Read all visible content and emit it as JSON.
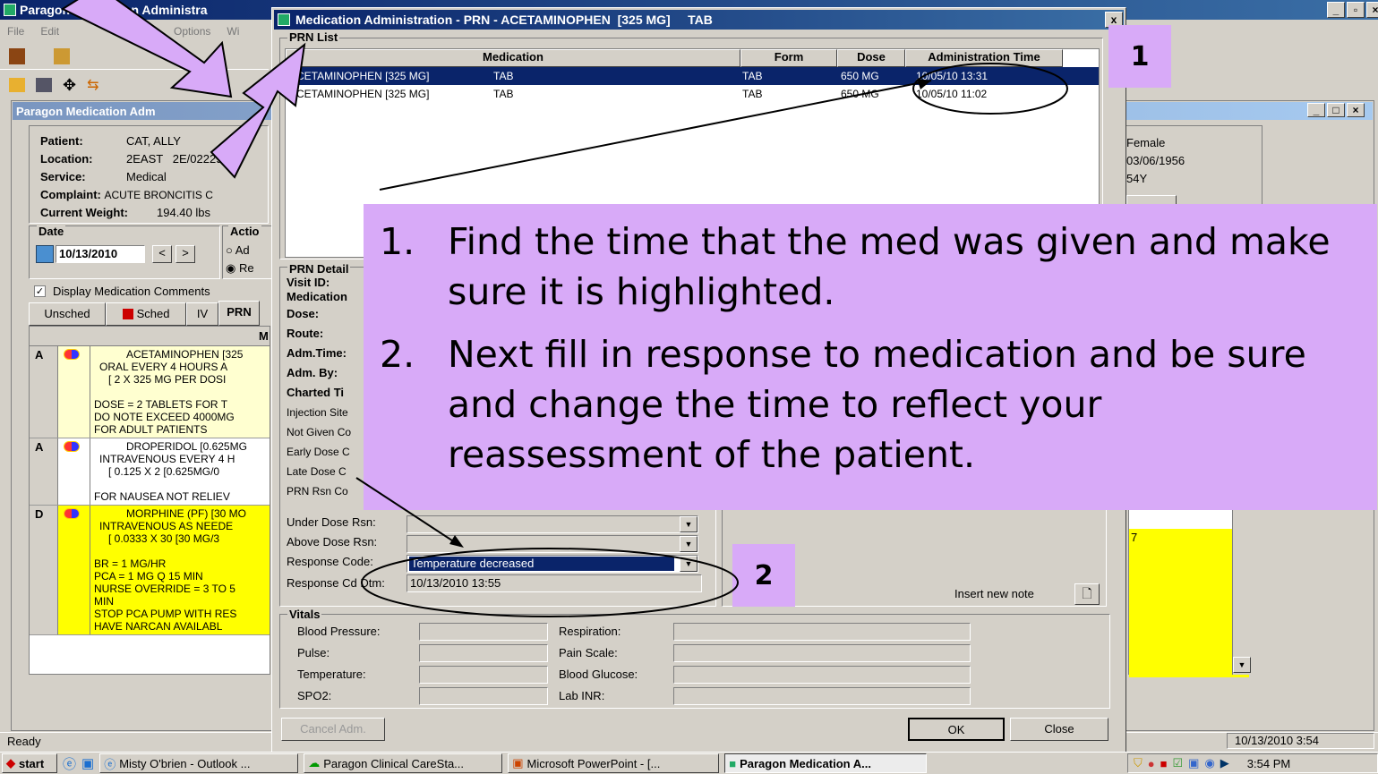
{
  "main_window": {
    "title": "Paragon Medication Administra",
    "menus": [
      "File",
      "Edit",
      "Options",
      "Wi"
    ]
  },
  "child_window": {
    "title": "Paragon Medication Adm"
  },
  "patient": {
    "patient_label": "Patient:",
    "patient_value": "CAT, ALLY",
    "location_label": "Location:",
    "location_value": "2EAST   2E/02229/A",
    "service_label": "Service:",
    "service_value": "Medical",
    "complaint_label": "Complaint:",
    "complaint_value": "ACUTE BRONCITIS C",
    "weight_label": "Current Weight:",
    "weight_value": "194.40 lbs",
    "sex": "Female",
    "dob": "03/06/1956",
    "age": "54Y"
  },
  "date_group": {
    "label": "Date",
    "value": "10/13/2010",
    "prev": "<",
    "next": ">"
  },
  "action_group": {
    "label": "Actio",
    "opt1": "Ad",
    "opt2": "Re"
  },
  "display_comments": "Display Medication Comments",
  "tabs": [
    "Unsched",
    "Sched",
    "IV",
    "PRN"
  ],
  "med_header": "M",
  "med_rows": [
    {
      "status": "A",
      "lines": [
        "ACETAMINOPHEN  [325",
        "ORAL EVERY 4 HOURS A",
        "[ 2 X 325 MG PER DOSI",
        "",
        "DOSE = 2 TABLETS FOR T",
        "DO NOTE EXCEED 4000MG",
        "FOR ADULT PATIENTS"
      ]
    },
    {
      "status": "A",
      "lines": [
        "DROPERIDOL  [0.625MG",
        "INTRAVENOUS EVERY 4 H",
        "[ 0.125 X 2 [0.625MG/0",
        "",
        "FOR NAUSEA NOT RELIEV"
      ]
    },
    {
      "status": "D",
      "lines": [
        "MORPHINE (PF)  [30 MO",
        "INTRAVENOUS AS NEEDE",
        "[ 0.0333 X 30 [30 MG/3",
        "",
        "BR = 1 MG/HR",
        "PCA = 1 MG Q 15 MIN",
        "NURSE OVERRIDE = 3 TO 5",
        "MIN",
        "STOP PCA PUMP WITH RES",
        "HAVE NARCAN AVAILABL"
      ]
    }
  ],
  "right_col_value": "7",
  "status_bar": {
    "left": "Ready",
    "right": "10/13/2010 3:54"
  },
  "dialog": {
    "title": "Medication Administration - PRN - ACETAMINOPHEN  [325 MG]     TAB",
    "close": "x",
    "prn_list_label": "PRN List",
    "columns": [
      "Medication",
      "Form",
      "Dose",
      "Administration Time"
    ],
    "rows": [
      {
        "med": "ACETAMINOPHEN  [325 MG]",
        "tab": "TAB",
        "form": "TAB",
        "dose": "650 MG",
        "time": "10/05/10 13:31"
      },
      {
        "med": "ACETAMINOPHEN  [325 MG]",
        "tab": "TAB",
        "form": "TAB",
        "dose": "650 MG",
        "time": "10/05/10 11:02"
      }
    ],
    "prn_detail_label": "PRN Detail",
    "detail_labels": [
      "Visit ID:",
      "Medication",
      "Dose:",
      "Route:",
      "Adm.Time:",
      "Adm. By:",
      "Charted Ti",
      "Injection Site",
      "Not Given Co",
      "Early Dose C",
      "Late Dose C",
      "PRN Rsn Co"
    ],
    "under_dose": "Under Dose Rsn:",
    "above_dose": "Above Dose Rsn:",
    "response_code_label": "Response Code:",
    "response_code_value": "Temperature decreased",
    "response_dtm_label": "Response Cd Dtm:",
    "response_dtm_value": "10/13/2010 13:55",
    "insert_note": "Insert new note",
    "vitals_label": "Vitals",
    "vitals_left": [
      "Blood Pressure:",
      "Pulse:",
      "Temperature:",
      "SPO2:"
    ],
    "vitals_right": [
      "Respiration:",
      "Pain Scale:",
      "Blood Glucose:",
      "Lab INR:"
    ],
    "cancel": "Cancel Adm.",
    "ok": "OK",
    "close_btn": "Close"
  },
  "callouts": {
    "one": "1",
    "two": "2",
    "item1_num": "1.",
    "item1": "Find the time that the med was given and make sure it is highlighted.",
    "item2_num": "2.",
    "item2": "Next fill in response to medication and be sure and change the time to reflect your reassessment of the patient."
  },
  "taskbar": {
    "start": "start",
    "items": [
      "Misty O'brien - Outlook ...",
      "Paragon Clinical CareSta...",
      "Microsoft PowerPoint - [...",
      "Paragon Medication A..."
    ],
    "clock": "3:54 PM"
  },
  "colors": {
    "accent": "#d8aaf8",
    "title_bar": "#0a246a",
    "highlight_row": "#0a246a",
    "yellow_row": "#ffff00",
    "pale_row": "#ffffd0"
  }
}
